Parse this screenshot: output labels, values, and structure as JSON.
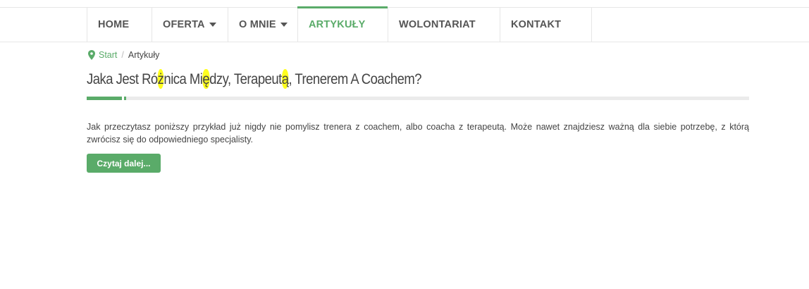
{
  "nav": {
    "items": [
      {
        "label": "HOME",
        "dropdown": false,
        "active": false
      },
      {
        "label": "OFERTA",
        "dropdown": true,
        "active": false
      },
      {
        "label": "O MNIE",
        "dropdown": true,
        "active": false
      },
      {
        "label": "ARTYKUŁY",
        "dropdown": false,
        "active": true
      },
      {
        "label": "WOLONTARIAT",
        "dropdown": false,
        "active": false
      },
      {
        "label": "KONTAKT",
        "dropdown": false,
        "active": false
      }
    ]
  },
  "breadcrumb": {
    "icon": "map-marker-icon",
    "start": "Start",
    "separator": "/",
    "current": "Artykuły"
  },
  "article": {
    "title_parts": {
      "p1": "Jaka Jest Ró",
      "h1": "ż",
      "p2": "nica Mi",
      "h2": "ę",
      "p3": "dzy, Terapeut",
      "h3": "ą",
      "p4": ", Trenerem A Coachem?"
    },
    "excerpt": "Jak przeczytasz poniższy przykład już nigdy nie pomylisz trenera z coachem, albo coacha z terapeutą. Może nawet znajdziesz ważną dla siebie potrzebę, z którą zwrócisz się do odpowiedniego specjalisty.",
    "read_more": "Czytaj dalej..."
  },
  "colors": {
    "accent": "#5aab69",
    "highlight": "#ffff1f",
    "text": "#444444",
    "nav_text": "#555555"
  }
}
